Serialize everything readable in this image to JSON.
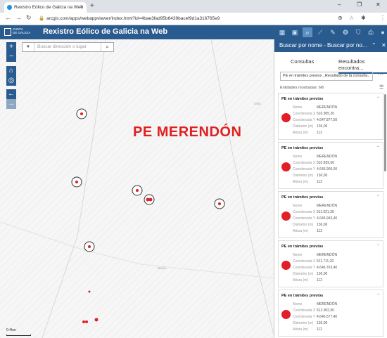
{
  "browser": {
    "tab_title": "Rexistro Eólico de Galicia na Web",
    "tab_close": "×",
    "new_tab": "+",
    "url": "arcgis.com/apps/webappviewer/index.html?id=4bae3fad95b6439bacef9d1a316765e9",
    "minimize": "–",
    "restore": "❐",
    "close": "✕"
  },
  "app": {
    "logo_line1": "XUNTA",
    "logo_line2": "DE GALICIA",
    "title": "Rexistro Eólico de Galicia na Web"
  },
  "map": {
    "search_placeholder": "Buscar dirección o lugar",
    "overlay_title": "PE MERENDÓN",
    "scale_label": "0.4km",
    "labels": [
      "Obla",
      "Borpa"
    ]
  },
  "panel": {
    "title": "Buscar por nome - Buscar por no...",
    "tabs": [
      "Consultas",
      "Resultados encontra..."
    ],
    "selected_layer": "PE en trámites previos _Resultado de la consulta",
    "count_text": "Entidades mostradas: 6/6",
    "results": [
      {
        "title": "PE en trámites previos",
        "nome_label": "Nome",
        "nome": "MERENDÓN",
        "cx_label": "Coordenada X",
        "cx": "510.905,20",
        "cy_label": "Coordenada Y",
        "cy": "4.647.877,50",
        "diam_label": "Diámetro (m)",
        "diam": "136,00",
        "alt_label": "Altura (m)",
        "alt": "112"
      },
      {
        "title": "PE en trámites previos",
        "nome_label": "Nome",
        "nome": "MERENDÓN",
        "cx_label": "Coordenada X",
        "cx": "510.839,00",
        "cy_label": "Coordenada Y",
        "cy": "4.646.900,00",
        "diam_label": "Diámetro (m)",
        "diam": "136,00",
        "alt_label": "Altura (m)",
        "alt": "112"
      },
      {
        "title": "PE en trámites previos",
        "nome_label": "Nome",
        "nome": "MERENDÓN",
        "cx_label": "Coordenada X",
        "cx": "511.021,30",
        "cy_label": "Coordenada Y",
        "cy": "4.645.943,40",
        "diam_label": "Diámetro (m)",
        "diam": "136,00",
        "alt_label": "Altura (m)",
        "alt": "112"
      },
      {
        "title": "PE en trámites previos",
        "nome_label": "Nome",
        "nome": "MERENDÓN",
        "cx_label": "Coordenada X",
        "cx": "511.711,20",
        "cy_label": "Coordenada Y",
        "cy": "4.646.763,40",
        "diam_label": "Diámetro (m)",
        "diam": "136,00",
        "alt_label": "Altura (m)",
        "alt": "112"
      },
      {
        "title": "PE en trámites previos",
        "nome_label": "Nome",
        "nome": "MERENDÓN",
        "cx_label": "Coordenada X",
        "cx": "512.902,50",
        "cy_label": "Coordenada Y",
        "cy": "4.646.577,40",
        "diam_label": "Diámetro (m)",
        "diam": "136,00",
        "alt_label": "Altura (m)",
        "alt": "112"
      }
    ]
  },
  "colors": {
    "header": "#2a5b8f",
    "marker": "#e21f26",
    "title": "#e02020"
  }
}
